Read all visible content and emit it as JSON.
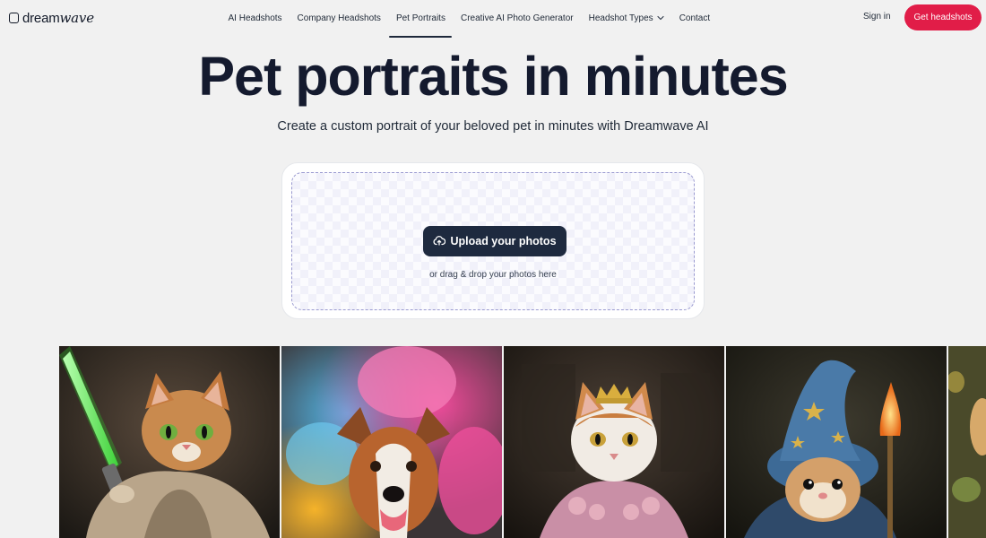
{
  "brand": {
    "name_part1": "dream",
    "name_part2": "wave"
  },
  "nav": {
    "links": [
      {
        "label": "AI Headshots"
      },
      {
        "label": "Company Headshots"
      },
      {
        "label": "Pet Portraits"
      },
      {
        "label": "Creative AI Photo Generator"
      },
      {
        "label": "Headshot Types"
      },
      {
        "label": "Contact"
      }
    ],
    "active": "Pet Portraits",
    "sign_in": "Sign in",
    "cta": "Get headshots"
  },
  "hero": {
    "title": "Pet portraits in minutes",
    "subtitle": "Create a custom portrait of your beloved pet in minutes with Dreamwave AI"
  },
  "upload": {
    "button_label": "Upload your photos",
    "button_icon": "cloud-upload-icon",
    "hint": "or drag & drop your photos here"
  },
  "gallery": {
    "images": [
      {
        "name": "kitten-jedi-lightsaber"
      },
      {
        "name": "dog-color-powder"
      },
      {
        "name": "cat-with-crown"
      },
      {
        "name": "hamster-wizard"
      },
      {
        "name": "partial-portrait"
      }
    ]
  },
  "colors": {
    "accent": "#e11d48",
    "primary_dark": "#1e2a3f",
    "background": "#f1f1f1",
    "text": "#141a2e"
  }
}
